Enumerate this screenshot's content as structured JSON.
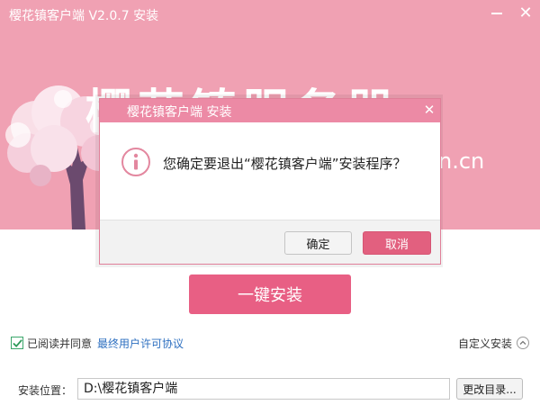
{
  "window": {
    "title": "樱花镇客户端 V2.0.7 安装"
  },
  "banner": {
    "big_title": "樱花镇服务器",
    "site_suffix": "n.cn"
  },
  "main": {
    "install_label": "一键安装",
    "agree_label": "已阅读并同意",
    "license_link": "最终用户许可协议",
    "custom_install_label": "自定义安装",
    "location_label": "安装位置：",
    "location_value": "D:\\樱花镇客户端",
    "browse_label": "更改目录..."
  },
  "dialog": {
    "title": "樱花镇客户端 安装",
    "message": "您确定要退出“樱花镇客户端”安装程序？",
    "ok_label": "确定",
    "cancel_label": "取消"
  },
  "icons": {
    "minimize": "minimize-icon",
    "close": "close-icon",
    "info": "info-icon",
    "check": "check-icon",
    "chevron": "chevron-up-icon"
  },
  "colors": {
    "banner": "#f0a1b3",
    "accent": "#e85f84",
    "dialog_title": "#ec8aa5",
    "link": "#2d6fc0"
  }
}
